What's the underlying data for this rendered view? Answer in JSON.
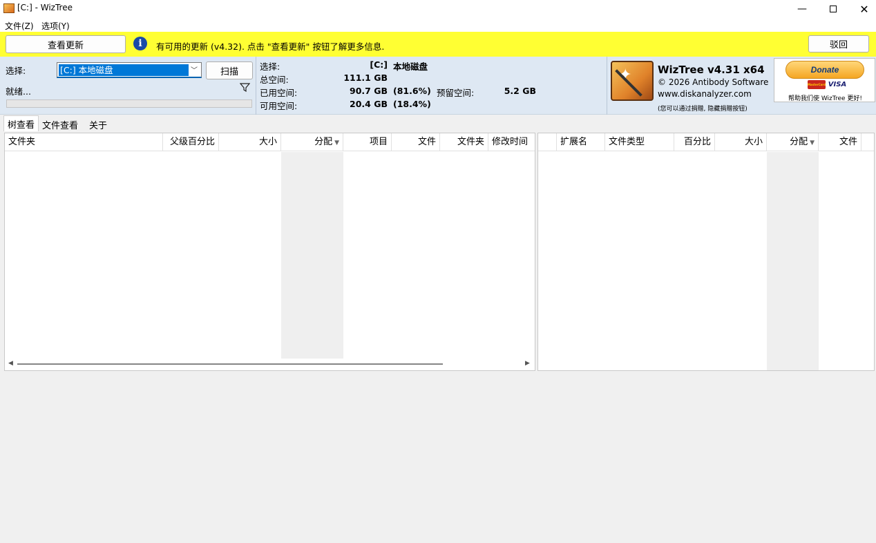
{
  "window": {
    "title": "[C:]  - WizTree"
  },
  "menu": {
    "file": "文件(Z)",
    "options": "选项(Y)"
  },
  "update_bar": {
    "check_button": "查看更新",
    "message": "有可用的更新 (v4.32). 点击 \"查看更新\" 按钮了解更多信息.",
    "dismiss_button": "驳回"
  },
  "scan": {
    "select_label": "选择:",
    "drive_value": "[C:] 本地磁盘",
    "scan_button": "扫描",
    "status": "就绪..."
  },
  "disk": {
    "select_label": "选择:",
    "drive_letter": "[C:]",
    "drive_name": "本地磁盘",
    "total_label": "总空间:",
    "total_value": "111.1 GB",
    "used_label": "已用空间:",
    "used_value": "90.7 GB",
    "used_pct": "(81.6%)",
    "reserved_label": "预留空间:",
    "reserved_value": "5.2 GB",
    "free_label": "可用空间:",
    "free_value": "20.4 GB",
    "free_pct": "(18.4%)"
  },
  "about": {
    "product": "WizTree v4.31 x64",
    "copyright": "© 2026 Antibody Software",
    "website": "www.diskanalyzer.com",
    "note": "(您可以通过捐赠, 隐藏捐赠按钮)"
  },
  "donate": {
    "button": "Donate",
    "card_mastercard": "MasterCard",
    "card_visa": "VISA",
    "caption": "帮助我们使 WizTree 更好!"
  },
  "tabs": [
    "树查看",
    "文件查看",
    "关于"
  ],
  "tree_columns": [
    "文件夹",
    "父级百分比",
    "大小",
    "分配",
    "项目",
    "文件",
    "文件夹",
    "修改时间"
  ],
  "ext_columns": [
    "扩展名",
    "文件类型",
    "百分比",
    "大小",
    "分配",
    "文件"
  ],
  "icons": {
    "app": "wiztree-app-icon",
    "info": "info-icon",
    "filter": "filter-icon",
    "logo": "wiztree-wand-logo"
  }
}
